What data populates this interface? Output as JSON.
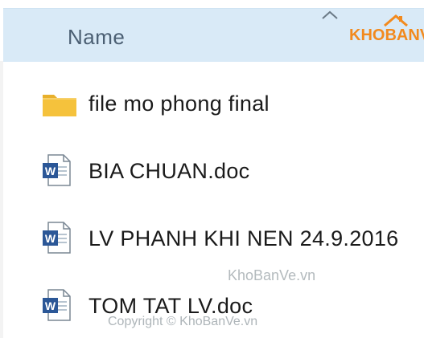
{
  "header": {
    "column_label": "Name",
    "sort_icon": "chevron-up-icon"
  },
  "logo": {
    "text": "KHOBANVE"
  },
  "files": [
    {
      "name": "file mo phong final",
      "icon": "folder-icon"
    },
    {
      "name": "BIA CHUAN.doc",
      "icon": "word-doc-icon"
    },
    {
      "name": "LV PHANH KHI NEN 24.9.2016",
      "icon": "word-doc-icon"
    },
    {
      "name": "TOM TAT LV.doc",
      "icon": "word-doc-icon"
    }
  ],
  "watermark": {
    "site": "KhoBanVe.vn",
    "copyright": "Copyright © KhoBanVe.vn"
  },
  "colors": {
    "header_bg": "#d9eaf7",
    "folder": "#f5c84a",
    "word_blue": "#2b5797",
    "logo_orange": "#f28a1e"
  }
}
